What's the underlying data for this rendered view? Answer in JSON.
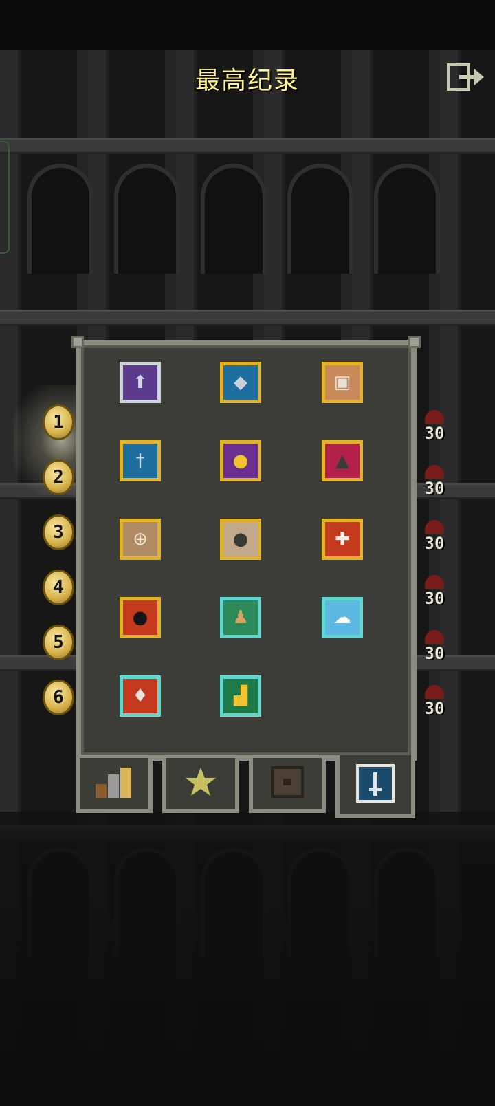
{
  "screen": {
    "title": "最高纪录"
  },
  "rankings": [
    {
      "rank": "1",
      "score": "30"
    },
    {
      "rank": "2",
      "score": "30"
    },
    {
      "rank": "3",
      "score": "30"
    },
    {
      "rank": "4",
      "score": "30"
    },
    {
      "rank": "5",
      "score": "30"
    },
    {
      "rank": "6",
      "score": "30"
    }
  ],
  "badges": [
    {
      "icon": "up-arrow-icon",
      "frame": "silver",
      "bg": "#5c3b8f",
      "glyph": "⬆",
      "glyph_color": "#cfd7e6"
    },
    {
      "icon": "fish-icon",
      "frame": "gold",
      "bg": "#1f6ea0",
      "glyph": "◆",
      "glyph_color": "#c8d0dc"
    },
    {
      "icon": "briefcase-icon",
      "frame": "gold",
      "bg": "#c98a5a",
      "glyph": "▣",
      "glyph_color": "#e7e2d8"
    },
    {
      "icon": "sword-icon",
      "frame": "gold",
      "bg": "#1f6ea0",
      "glyph": "†",
      "glyph_color": "#d4dbe5"
    },
    {
      "icon": "coin-icon",
      "frame": "gold",
      "bg": "#6a2f8f",
      "glyph": "●",
      "glyph_color": "#f2c230"
    },
    {
      "icon": "padlock-icon",
      "frame": "gold",
      "bg": "#b3204a",
      "glyph": "▲",
      "glyph_color": "#3a3a3a"
    },
    {
      "icon": "wheel-icon",
      "frame": "gold",
      "bg": "#b08a64",
      "glyph": "⊕",
      "glyph_color": "#efe7d3"
    },
    {
      "icon": "boulder-icon",
      "frame": "gold",
      "bg": "#c4a88a",
      "glyph": "●",
      "glyph_color": "#3a3a34"
    },
    {
      "icon": "cross-icon",
      "frame": "gold",
      "bg": "#c33a1e",
      "glyph": "✚",
      "glyph_color": "#f0eee8"
    },
    {
      "icon": "bomb-icon",
      "frame": "gold",
      "bg": "#c33a1e",
      "glyph": "●",
      "glyph_color": "#141414"
    },
    {
      "icon": "pawn-icon",
      "frame": "teal",
      "bg": "#2e8a5a",
      "glyph": "♟",
      "glyph_color": "#d9a060"
    },
    {
      "icon": "cloud-icon",
      "frame": "teal",
      "bg": "#5cb8e0",
      "glyph": "☁",
      "glyph_color": "#ffffff"
    },
    {
      "icon": "heart-icon",
      "frame": "teal",
      "bg": "#c33a1e",
      "glyph": "♦",
      "glyph_color": "#e8e3dc"
    },
    {
      "icon": "bar-chart-icon",
      "frame": "teal",
      "bg": "#1e7a4a",
      "glyph": "▟",
      "glyph_color": "#f2c230"
    }
  ],
  "tabs": [
    {
      "icon": "leaderboard-bars-icon",
      "active": false
    },
    {
      "icon": "star-icon",
      "active": false
    },
    {
      "icon": "journal-book-icon",
      "active": false
    },
    {
      "icon": "sword-badge-icon",
      "active": true
    }
  ],
  "colors": {
    "title": "#fff38a",
    "frame_gold": "#e2b32a",
    "frame_silver": "#cfd2d8",
    "frame_teal": "#5fd7cf",
    "panel_bg": "#3d3d38",
    "panel_border": "#8c8c80"
  }
}
